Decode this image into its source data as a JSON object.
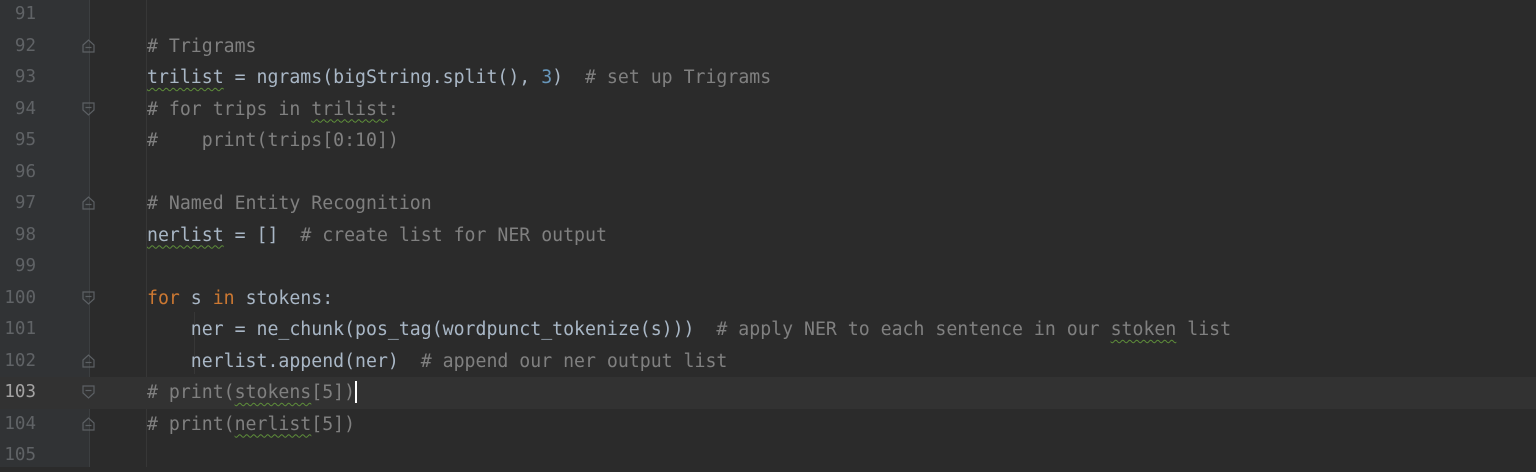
{
  "editor": {
    "current_line": "103",
    "lines": [
      {
        "num": "91"
      },
      {
        "num": "92",
        "t1": "# Trigrams"
      },
      {
        "num": "93",
        "t1": "trilist",
        "t2": " = ngrams(bigString.split(), ",
        "t3": "3",
        "t4": ")  ",
        "t5": "# set up Trigrams"
      },
      {
        "num": "94",
        "t1": "# for trips in ",
        "t2": "trilist",
        "t3": ":"
      },
      {
        "num": "95",
        "t1": "#    print(trips[0:10])"
      },
      {
        "num": "96"
      },
      {
        "num": "97",
        "t1": "# Named Entity Recognition"
      },
      {
        "num": "98",
        "t1": "nerlist",
        "t2": " = []  ",
        "t3": "# create list for NER output"
      },
      {
        "num": "99"
      },
      {
        "num": "100",
        "t1": "for",
        "t2": " s ",
        "t3": "in",
        "t4": " stokens:"
      },
      {
        "num": "101",
        "t1": "    ner = ne_chunk(pos_tag(wordpunct_tokenize(s)))  ",
        "t2": "# apply NER to each sentence in our ",
        "t3": "stoken",
        "t4": " list"
      },
      {
        "num": "102",
        "t1": "    nerlist.append(ner)  ",
        "t2": "# append our ner output list"
      },
      {
        "num": "103",
        "t1": "# print(",
        "t2": "stokens",
        "t3": "[5])"
      },
      {
        "num": "104",
        "t1": "# print(",
        "t2": "nerlist",
        "t3": "[5])"
      },
      {
        "num": "105"
      }
    ]
  },
  "colors": {
    "background": "#2b2b2b",
    "gutter": "#313335",
    "comment": "#808080",
    "keyword": "#cc7832",
    "number": "#6897bb",
    "identifier": "#a9b7c6",
    "current_line_highlight": "#323232"
  },
  "icons": {
    "fold_start": "fold-start-icon",
    "fold_end": "fold-end-icon"
  }
}
